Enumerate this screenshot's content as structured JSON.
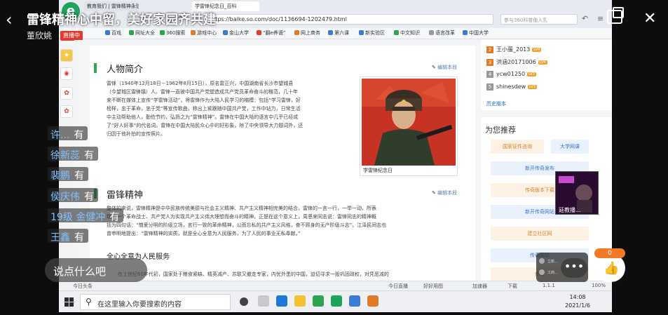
{
  "stream": {
    "title": "雷锋精神心中留，美好家园齐共建",
    "host": "董欣姚",
    "back_icon": "chevron-left-icon",
    "close_icon": "close-icon"
  },
  "browser": {
    "tabs": [
      {
        "label": "教育我们 | 雷锋精神永驻"
      },
      {
        "label": "学雷锋纪念日_百科"
      }
    ],
    "url": "https://baike.so.com/doc/1136694-1202479.html",
    "search_placeholder": "参与360科普值入扎",
    "bookmarks": [
      {
        "label": "百戏",
        "color": "#3a7bd5"
      },
      {
        "label": "网址大全",
        "color": "#2ea44f"
      },
      {
        "label": "360搜索",
        "color": "#2ea44f"
      },
      {
        "label": "游戏中心",
        "color": "#e07b2a"
      },
      {
        "label": "金山大学",
        "color": "#3a7bd5"
      },
      {
        "label": "“翻e养语”",
        "color": "#e03c31"
      },
      {
        "label": "网上商务",
        "color": "#e07b2a"
      },
      {
        "label": "第六课",
        "color": "#3a7bd5"
      },
      {
        "label": "新实验区",
        "color": "#3a7bd5"
      },
      {
        "label": "中文知识",
        "color": "#2ea44f"
      },
      {
        "label": "语言改革",
        "color": "#999999"
      },
      {
        "label": "中国大学",
        "color": "#3a7bd5"
      }
    ],
    "side_label": "直播中"
  },
  "article": {
    "intro_title": "人物简介",
    "intro_edit": "编辑本段",
    "intro_text": [
      "雷锋（1940年12月18日－1962年8月15日），原名雷正兴，中国湖南省长沙市望城县",
      "（今望城区雷锋镇）人。雷锋一直被中国共产党塑造成共产党员革命奋斗的楷范，几十年",
      "来不断在媒体上宣传“学雷锋活动”，将雷锋作为大陆人民学习的楷模：包括“学习雷锋，好",
      "榜样，忠于革命，忠于党”等宣传歌曲，称出上紧跟随中国共产党，工作中钻力，日常生活",
      "中主动帮助他人，勤俭节约，弘扬之为“雷锋精神”。雷锋在中国大陆的语言中几乎已经成",
      "了“好人好事”的代名词。雷锋在中国大陆民众心中的好形象，除了中央领导大力题词外，还",
      "归因于他补拍的宣传照片。"
    ],
    "portrait_caption": "学雷锋纪念日",
    "spirit_title": "雷锋精神",
    "spirit_edit": "编辑本段",
    "spirit_text": [
      "整体的来说，雷锋精神是中华民族传统美德与社会主义精神、共产主义精神相完美的结合，雷锋的一言一行，一举一动，所表",
      "现的一个革命战士、共产党人为实现共产主义伟大理想而奋斗的精神。正是在这个意义上，周恩来同志说：雷锋同志的精神概",
      "括为四句话：“憎爱分明的阶级立场，言行一致的革命精神，公而忘私的共产主义风格，奋不顾身的无产阶级斗志”。江泽民同志也",
      "曾申明地提出：“雷锋精神的实质，就是全心全意为人民服务，为了人民的事业无私奉献。”"
    ],
    "sub_title": "全心全意为人民服务",
    "sub_text": "在上世纪60年代初，国家处于粮食紧缺、精英减产、苏联又撤走专家，内忧外患的中国，迫切寻求一股巩固政权，对凭恶减的"
  },
  "contributors": {
    "items": [
      {
        "rank": "2",
        "name": "王小蛋_2013",
        "badge": "LV4",
        "hot": true
      },
      {
        "rank": "3",
        "name": "洪涵20171006",
        "badge": "LV4",
        "hot": true
      },
      {
        "rank": "4",
        "name": "ycw01250",
        "badge": "LV3",
        "hot": false
      },
      {
        "rank": "5",
        "name": "shinesdew",
        "badge": "LV3",
        "hot": false
      }
    ],
    "more": "历史版本"
  },
  "recommend": {
    "title": "为您推荐",
    "buttons": [
      {
        "label": "国家证件咨询",
        "style": "orange"
      },
      {
        "label": "大学网课",
        "style": "blue"
      },
      {
        "label": "新开传奇发布",
        "style": "blue"
      },
      {
        "label": "传奇版本下载",
        "style": "orange"
      },
      {
        "label": "新开传奇网站",
        "style": "blue"
      },
      {
        "label": "建立社区网",
        "style": "orange"
      },
      {
        "label": "传奇网站",
        "style": "blue"
      },
      {
        "label": "传奇",
        "style": "orange"
      }
    ]
  },
  "page_bottom": {
    "left": "今日头条",
    "items": [
      "今日直播",
      "好好用图",
      "加速器",
      "下载",
      "1.1.1",
      "100%"
    ]
  },
  "taskbar": {
    "search_text": "在这里输入你要搜索的内容",
    "time": "14:08",
    "date": "2021/1/6"
  },
  "chat": {
    "messages": [
      {
        "name": "许...",
        "text": "有"
      },
      {
        "name": "徐新蕊",
        "text": "有"
      },
      {
        "name": "裴鹏",
        "text": "有"
      },
      {
        "name": "侯庆伟",
        "text": "有"
      },
      {
        "name": "19级 金健冲",
        "text": "有"
      },
      {
        "name": "王鑫",
        "text": "有"
      }
    ],
    "input_placeholder": "说点什么吧"
  },
  "live_thumb": {
    "label": "延教播..."
  },
  "viewers": [
    {
      "name": "立新..."
    },
    {
      "name": "工商..."
    }
  ],
  "more_button": "•••",
  "like": {
    "count": "0",
    "icon": "thumbs-up-icon"
  }
}
